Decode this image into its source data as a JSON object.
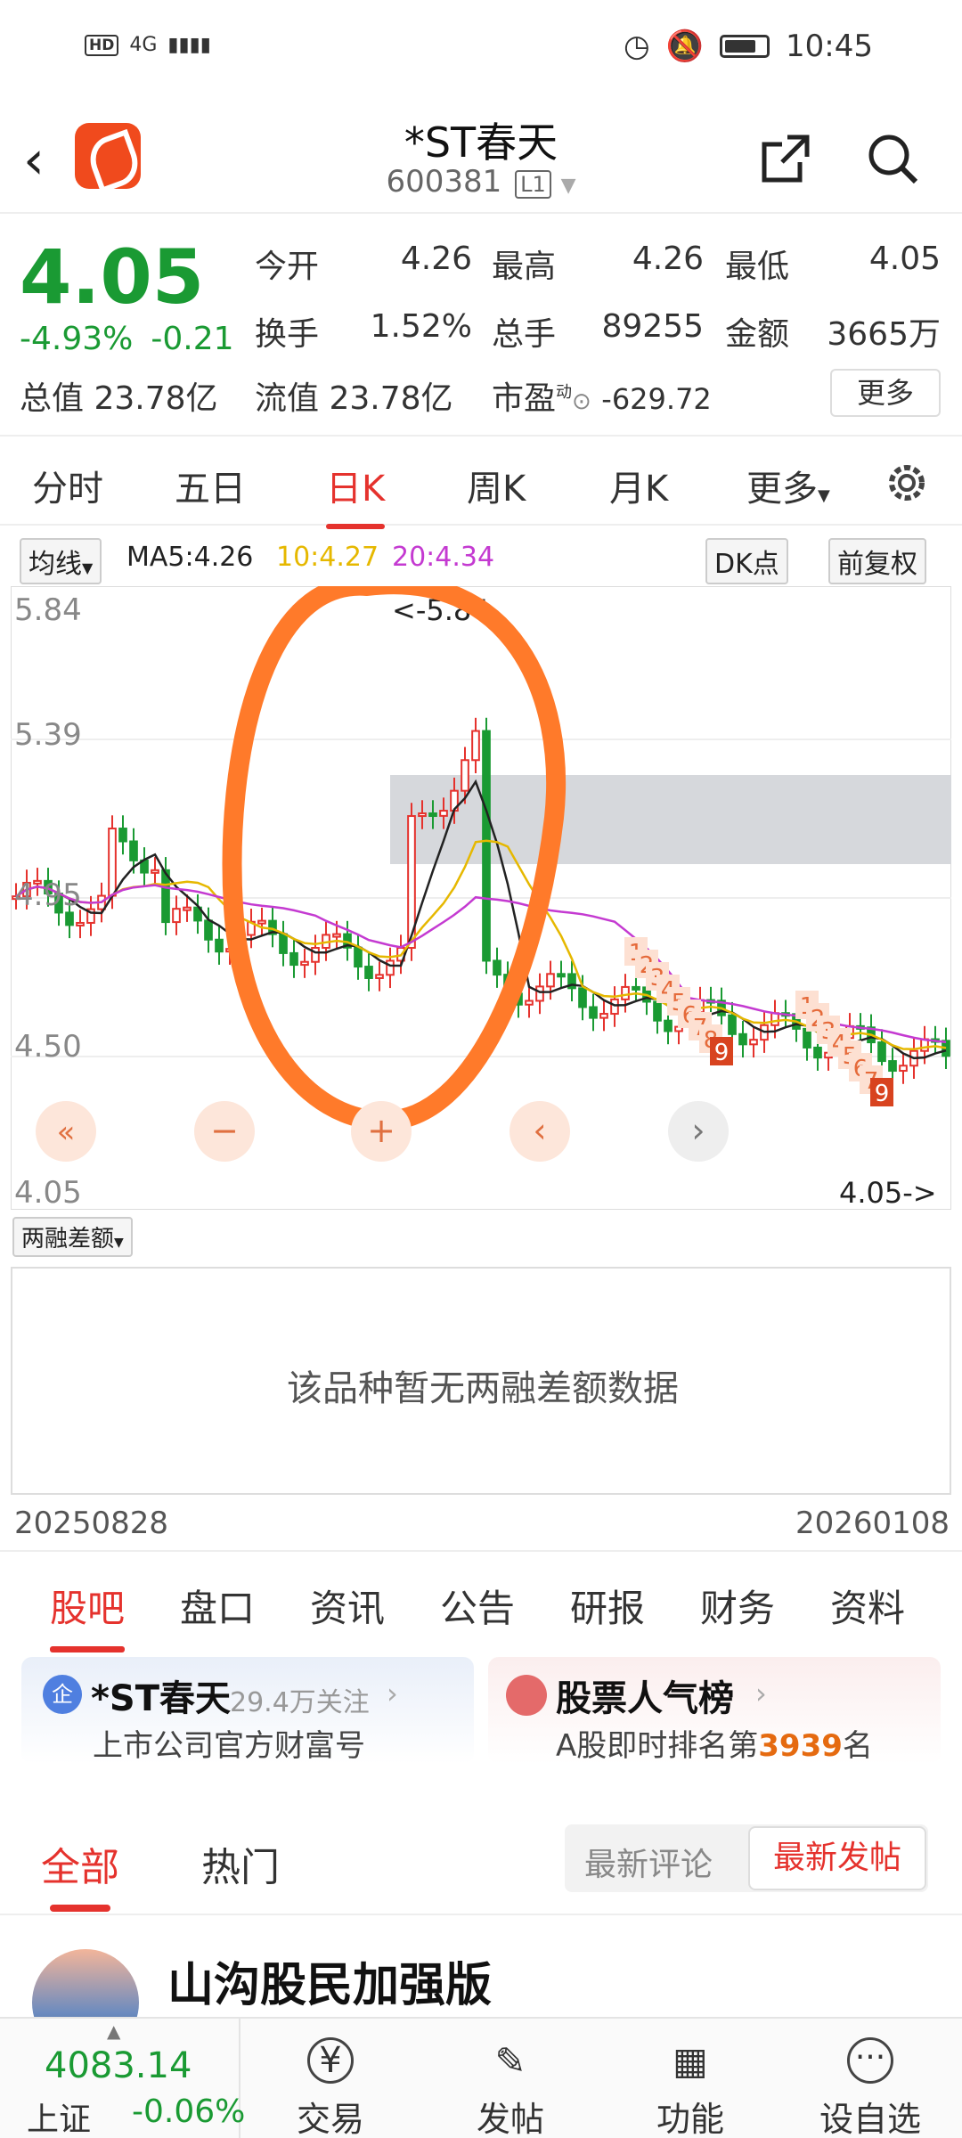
{
  "status_bar": {
    "left_badges": [
      "HD",
      "4G"
    ],
    "time": "10:45"
  },
  "header": {
    "title": "*ST春天",
    "code": "600381",
    "level": "L1"
  },
  "quote": {
    "price": "4.05",
    "change_pct": "-4.93%",
    "change_abs": "-0.21",
    "open_label": "今开",
    "open": "4.26",
    "high_label": "最高",
    "high": "4.26",
    "low_label": "最低",
    "low": "4.05",
    "turnover_label": "换手",
    "turnover": "1.52%",
    "volume_label": "总手",
    "volume": "89255",
    "amount_label": "金额",
    "amount": "3665万",
    "total_cap_label": "总值",
    "total_cap": "23.78亿",
    "float_cap_label": "流值",
    "float_cap": "23.78亿",
    "pe_label": "市盈",
    "pe_sup": "动",
    "pe": "-629.72",
    "more_label": "更多"
  },
  "kline_tabs": [
    "分时",
    "五日",
    "日K",
    "周K",
    "月K",
    "更多"
  ],
  "kline_active": "日K",
  "ma_row": {
    "selector": "均线",
    "ma5": "MA5:4.26",
    "ma10": "10:4.27",
    "ma20": "20:4.34",
    "dk": "DK点",
    "adjust": "前复权"
  },
  "chart_data": {
    "type": "candlestick",
    "y_ticks": [
      "5.84",
      "5.39",
      "4.95",
      "4.50",
      "4.05"
    ],
    "ylim": [
      4.05,
      5.84
    ],
    "max_label": "<-5.84",
    "last_label": "4.05->",
    "nine_turn_labels": [
      "1",
      "2",
      "3",
      "4",
      "5",
      "6",
      "7",
      "8",
      "9",
      "1",
      "2",
      "3",
      "4",
      "5",
      "6",
      "7",
      "9"
    ],
    "grid": true
  },
  "chart_controls": [
    "«",
    "−",
    "+",
    "‹",
    "›"
  ],
  "margin": {
    "selector": "两融差额",
    "empty_msg": "该品种暂无两融差额数据"
  },
  "date_range": {
    "start": "20250828",
    "end": "20260108"
  },
  "info_tabs": [
    "股吧",
    "盘口",
    "资讯",
    "公告",
    "研报",
    "财务",
    "资料"
  ],
  "cards": {
    "a_badge": "企",
    "a_title": "*ST春天",
    "a_follow": "29.4万关注",
    "a_sub": "上市公司官方财富号",
    "b_title": "股票人气榜",
    "b_sub_pre": "A股即时排名第",
    "b_rank": "3939",
    "b_sub_post": "名"
  },
  "feed_tabs": {
    "all": "全部",
    "hot": "热门",
    "sort_comment": "最新评论",
    "sort_post": "最新发帖"
  },
  "post": {
    "author": "山沟股民加强版"
  },
  "bottom_bar": {
    "index_value": "4083.14",
    "index_name": "上证",
    "index_change": "-0.06%",
    "nav": [
      "交易",
      "发帖",
      "功能",
      "设自选"
    ]
  },
  "colors": {
    "up": "#e5322d",
    "down": "#1a9a33",
    "accent": "#f04a1d",
    "annotation": "#ff7a2a"
  }
}
